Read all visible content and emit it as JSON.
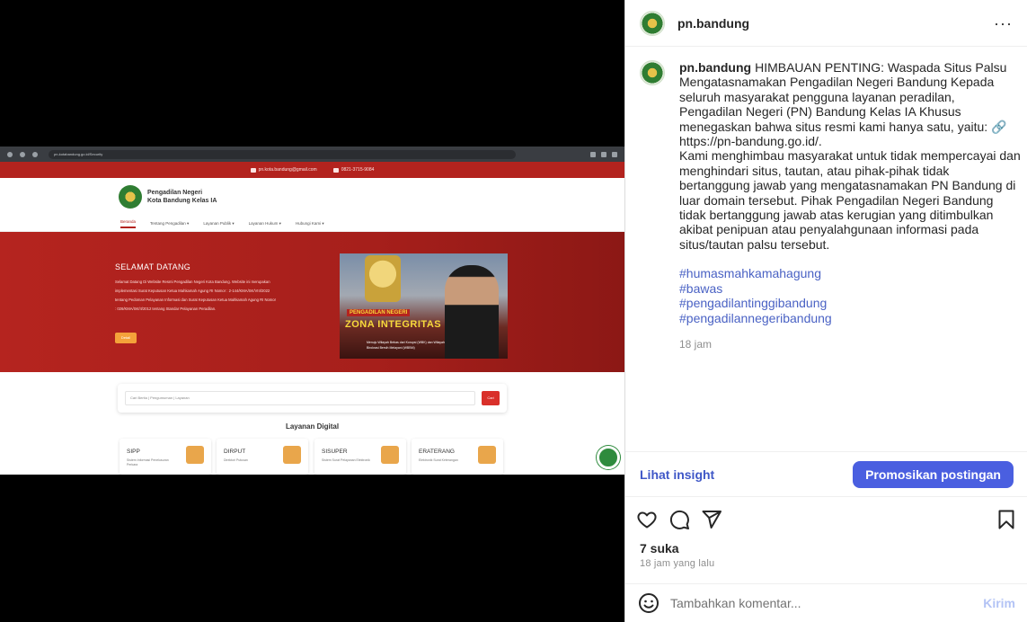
{
  "media": {
    "browser_url": "pn-kotabandung.go.id/Security",
    "site": {
      "email": "pn.kota.bandung@gmail.com",
      "phone": "0821-3715-9084",
      "name_line1": "Pengadilan Negeri",
      "name_line2": "Kota Bandung Kelas IA",
      "nav": [
        "Beranda",
        "Tentang Pengadilan ▾",
        "Layanan Publik ▾",
        "Layanan Hukum ▾",
        "Hubungi Kami ▾"
      ],
      "hero_title": "SELAMAT DATANG",
      "hero_text": "Selamat Datang Di Website Resmi Pengadilan Negeri Kota Bandung. Website ini merupakan implementasi Surat Keputusan Ketua Mahkamah Agung RI Nomor : 2-144/KMA/SK/VIII/2022 tentang Pedoman Pelayanan Informasi dan Surat Keputusan Ketua Mahkamah Agung RI Nomor : 026/KMA/SK/II/2012 tentang Standar Pelayanan Peradilan.",
      "hero_button": "Detail",
      "hero_image_title_small": "PENGADILAN NEGERI",
      "hero_image_title": "ZONA INTEGRITAS",
      "hero_image_caption": "Menuju Wilayah Bebas dari Korupsi (WBK) dan Wilayah Birokrasi Bersih Melayani (WBBM)",
      "search_placeholder": "Cari Berita | Pengumuman | Layanan",
      "search_button": "Cari",
      "digital_title": "Layanan Digital",
      "services": [
        {
          "name": "SIPP",
          "desc": "Sistem Informasi Penelusuran Perkara"
        },
        {
          "name": "DIRPUT",
          "desc": "Direktori Putusan"
        },
        {
          "name": "SISUPER",
          "desc": "Sistem Surat Pelayanan Elektronik"
        },
        {
          "name": "ERATERANG",
          "desc": "Elektronik Surat Keterangan"
        }
      ]
    }
  },
  "panel": {
    "username": "pn.bandung",
    "more_label": "···",
    "caption_user": "pn.bandung",
    "caption_text": "HIMBAUAN PENTING: Waspada Situs Palsu Mengatasnamakan Pengadilan Negeri Bandung Kepada seluruh masyarakat pengguna layanan peradilan, Pengadilan Negeri (PN) Bandung Kelas IA Khusus menegaskan bahwa situs resmi kami hanya satu, yaitu: 🔗 https://pn-bandung.go.id/.\nKami menghimbau masyarakat untuk tidak mempercayai dan menghindari situs, tautan, atau pihak-pihak tidak bertanggung jawab yang mengatasnamakan PN Bandung di luar domain tersebut. Pihak Pengadilan Negeri Bandung tidak bertanggung jawab atas kerugian yang ditimbulkan akibat penipuan atau penyalahgunaan informasi pada situs/tautan palsu tersebut.",
    "hashtags": [
      "#humasmahkamahagung",
      "#bawas",
      "#pengadilantinggibandung",
      "#pengadilannegeribandung"
    ],
    "caption_time": "18 jam",
    "insight_label": "Lihat insight",
    "promote_label": "Promosikan postingan",
    "likes": "7 suka",
    "posted_ago": "18 jam yang lalu",
    "comment_placeholder": "Tambahkan komentar...",
    "post_label": "Kirim"
  },
  "colors": {
    "court_red": "#b3231e",
    "link_blue": "#4a62c4",
    "promote_button": "#4a5fe0"
  }
}
